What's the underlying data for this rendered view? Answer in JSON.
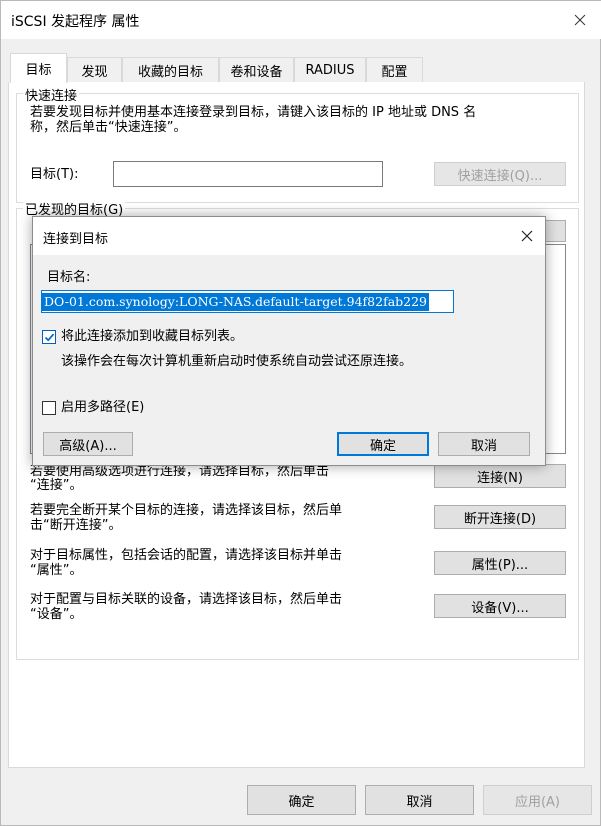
{
  "window": {
    "title": "iSCSI 发起程序 属性"
  },
  "tabs": [
    {
      "label": "目标",
      "active": true
    },
    {
      "label": "发现"
    },
    {
      "label": "收藏的目标"
    },
    {
      "label": "卷和设备"
    },
    {
      "label": "RADIUS"
    },
    {
      "label": "配置"
    }
  ],
  "quick_connect": {
    "group_label": "快速连接",
    "description_line1": "若要发现目标并使用基本连接登录到目标，请键入该目标的 IP 地址或 DNS 名",
    "description_line2": "称，然后单击“快速连接”。",
    "target_label": "目标(T):",
    "target_value": "",
    "button": "快速连接(Q)..."
  },
  "discovered": {
    "group_label": "已发现的目标(G)",
    "connect_desc_line1": "若要使用高级选项进行连接，请选择目标，然后单击",
    "connect_desc_line2": "“连接”。",
    "connect_button": "连接(N)",
    "disconnect_desc_line1": "若要完全断开某个目标的连接，请选择该目标，然后单",
    "disconnect_desc_line2": "击“断开连接”。",
    "disconnect_button": "断开连接(D)",
    "props_desc_line1": "对于目标属性，包括会话的配置，请选择该目标并单击",
    "props_desc_line2": "“属性”。",
    "props_button": "属性(P)...",
    "devices_desc_line1": "对于配置与目标关联的设备，请选择该目标，然后单击",
    "devices_desc_line2": "“设备”。",
    "devices_button": "设备(V)..."
  },
  "footer": {
    "ok": "确定",
    "cancel": "取消",
    "apply": "应用(A)"
  },
  "dialog": {
    "title": "连接到目标",
    "target_name_label": "目标名:",
    "target_name_value": "DO-01.com.synology:LONG-NAS.default-target.94f82fab229",
    "favorites_checkbox": {
      "label": "将此连接添加到收藏目标列表。",
      "checked": true
    },
    "favorites_note": "该操作会在每次计算机重新启动时使系统自动尝试还原连接。",
    "multipath_checkbox": {
      "label": "启用多路径(E)",
      "checked": false
    },
    "advanced_button": "高级(A)...",
    "ok_button": "确定",
    "cancel_button": "取消"
  }
}
